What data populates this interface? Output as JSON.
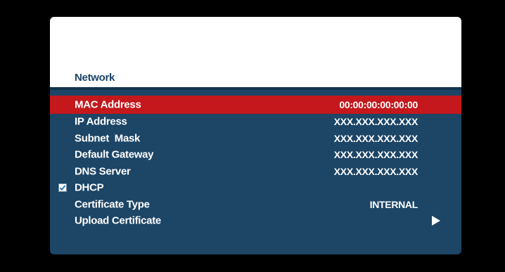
{
  "screen": {
    "title": "Network",
    "colors": {
      "panel": "#1c4566",
      "selected_row": "#c4181c",
      "header": "#ffffff",
      "background": "#000000"
    }
  },
  "rows": [
    {
      "label": "MAC Address",
      "value": "00:00:00:00:00:00",
      "selected": true
    },
    {
      "label": "IP Address",
      "value": "XXX.XXX.XXX.XXX"
    },
    {
      "label": "Subnet  Mask",
      "value": "XXX.XXX.XXX.XXX"
    },
    {
      "label": "Default Gateway",
      "value": "XXX.XXX.XXX.XXX"
    },
    {
      "label": "DNS Server",
      "value": "XXX.XXX.XXX.XXX"
    },
    {
      "label": "DHCP",
      "checked": true,
      "icon": "checkbox-checked-icon"
    },
    {
      "label": "Certificate Type",
      "value": "INTERNAL"
    },
    {
      "label": "Upload Certificate",
      "icon": "right-arrow-icon"
    }
  ]
}
